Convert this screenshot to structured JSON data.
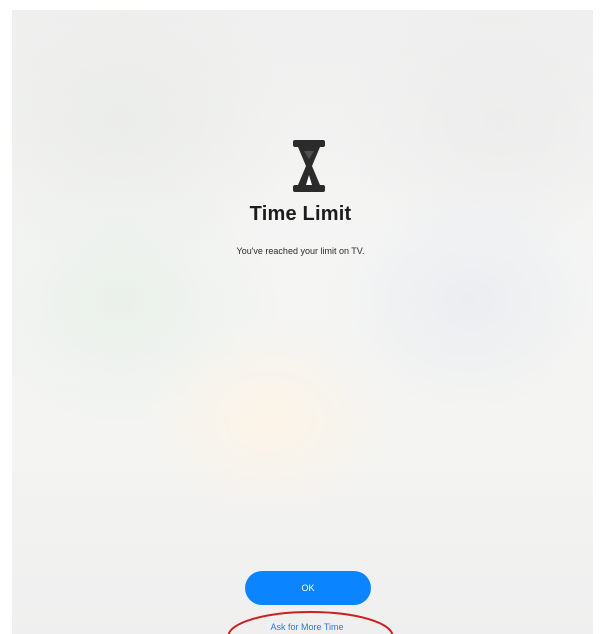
{
  "screen": {
    "title": "Time Limit",
    "message": "You've reached your limit on TV.",
    "icon": "hourglass-icon"
  },
  "actions": {
    "ok_label": "OK",
    "ask_label": "Ask for More Time"
  },
  "colors": {
    "accent": "#0a84ff",
    "link": "#2f79d7",
    "annotation": "#cc1f1f"
  }
}
